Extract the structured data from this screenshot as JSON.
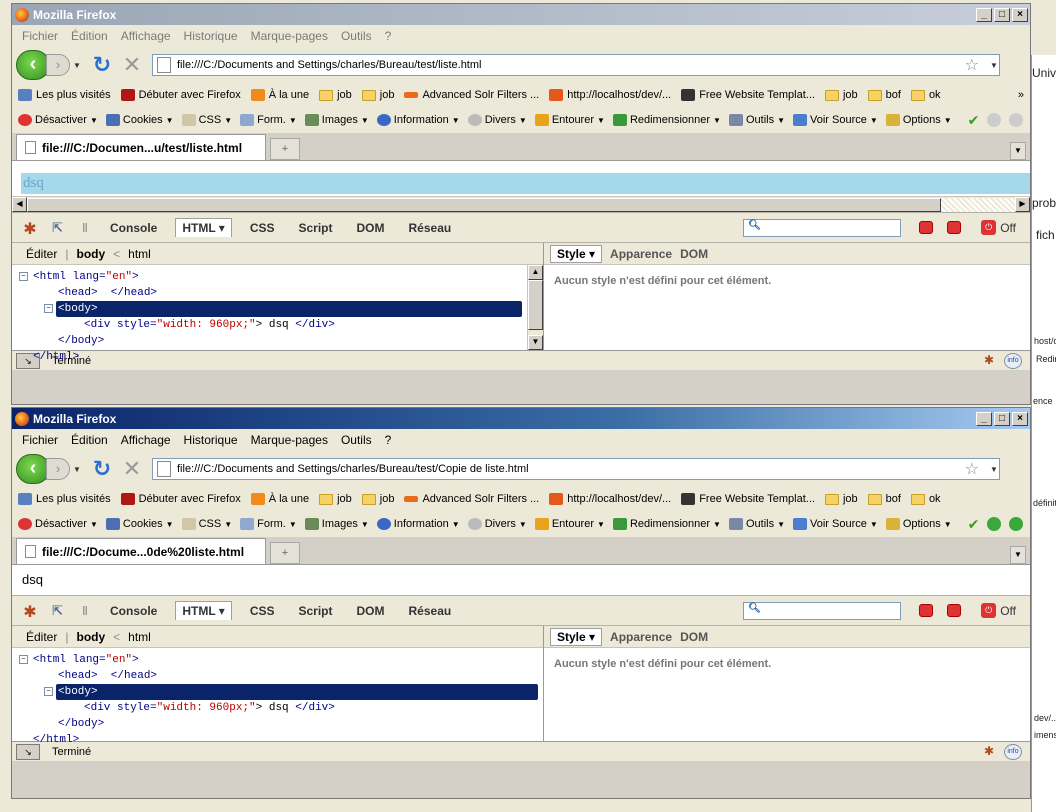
{
  "background": {
    "right_fragments": [
      "Univer",
      "prob",
      "fich",
      "host/de",
      "Redim",
      "ence",
      "définiti",
      "dev/...",
      "imensio"
    ]
  },
  "windows": [
    {
      "title": "Mozilla Firefox",
      "menu": [
        "Fichier",
        "Édition",
        "Affichage",
        "Historique",
        "Marque-pages",
        "Outils",
        "?"
      ],
      "url": "file:///C:/Documents and Settings/charles/Bureau/test/liste.html",
      "bookmarks": [
        "Les plus visités",
        "Débuter avec Firefox",
        "À la une",
        "job",
        "job",
        "Advanced Solr Filters ...",
        "http://localhost/dev/...",
        "Free Website Templat...",
        "job",
        "bof",
        "ok"
      ],
      "bookmarks_more": "»",
      "webdev": [
        "Désactiver",
        "Cookies",
        "CSS",
        "Form.",
        "Images",
        "Information",
        "Divers",
        "Entourer",
        "Redimensionner",
        "Outils",
        "Voir Source",
        "Options"
      ],
      "tab_label": "file:///C:/Documen...u/test/liste.html",
      "page_text": "dsq",
      "firebug": {
        "tabs": [
          "Console",
          "HTML",
          "CSS",
          "Script",
          "DOM",
          "Réseau"
        ],
        "selected_tab": "HTML",
        "off_label": "Off",
        "edit_label": "Éditer",
        "crumb_body": "body",
        "crumb_lt": "<",
        "crumb_html": "html",
        "side_tabs": [
          "Style",
          "Apparence",
          "DOM"
        ],
        "side_message": "Aucun style n'est défini pour cet élément.",
        "tree": {
          "html_open": "<html",
          "lang_attr": " lang=",
          "lang_val": "\"en\"",
          "gt": ">",
          "head": "<head>  </head>",
          "body_open": "<body>",
          "div_open": "<div",
          "style_attr": " style=",
          "style_val": "\"width: 960px;\"",
          "div_text": "> dsq ",
          "div_close": "</div>",
          "body_close": "</body>",
          "html_close": "</html>"
        }
      },
      "status": "Terminé"
    },
    {
      "title": "Mozilla Firefox",
      "menu": [
        "Fichier",
        "Édition",
        "Affichage",
        "Historique",
        "Marque-pages",
        "Outils",
        "?"
      ],
      "url": "file:///C:/Documents and Settings/charles/Bureau/test/Copie de liste.html",
      "bookmarks": [
        "Les plus visités",
        "Débuter avec Firefox",
        "À la une",
        "job",
        "job",
        "Advanced Solr Filters ...",
        "http://localhost/dev/...",
        "Free Website Templat...",
        "job",
        "bof",
        "ok"
      ],
      "bookmarks_more": "»",
      "webdev": [
        "Désactiver",
        "Cookies",
        "CSS",
        "Form.",
        "Images",
        "Information",
        "Divers",
        "Entourer",
        "Redimensionner",
        "Outils",
        "Voir Source",
        "Options"
      ],
      "tab_label": "file:///C:/Docume...0de%20liste.html",
      "page_text": "dsq",
      "firebug": {
        "tabs": [
          "Console",
          "HTML",
          "CSS",
          "Script",
          "DOM",
          "Réseau"
        ],
        "selected_tab": "HTML",
        "off_label": "Off",
        "edit_label": "Éditer",
        "crumb_body": "body",
        "crumb_lt": "<",
        "crumb_html": "html",
        "side_tabs": [
          "Style",
          "Apparence",
          "DOM"
        ],
        "side_message": "Aucun style n'est défini pour cet élément.",
        "tree": {
          "html_open": "<html",
          "lang_attr": " lang=",
          "lang_val": "\"en\"",
          "gt": ">",
          "head": "<head>  </head>",
          "body_open": "<body>",
          "div_open": "<div",
          "style_attr": " style=",
          "style_val": "\"width: 960px;\"",
          "div_text": "> dsq ",
          "div_close": "</div>",
          "body_close": "</body>",
          "html_close": "</html>"
        }
      },
      "status": "Terminé"
    }
  ],
  "colors": {
    "active_title": "#0a246a",
    "highlight_page": "#a6d8ec",
    "highlight_text": "#6aa6c8"
  }
}
